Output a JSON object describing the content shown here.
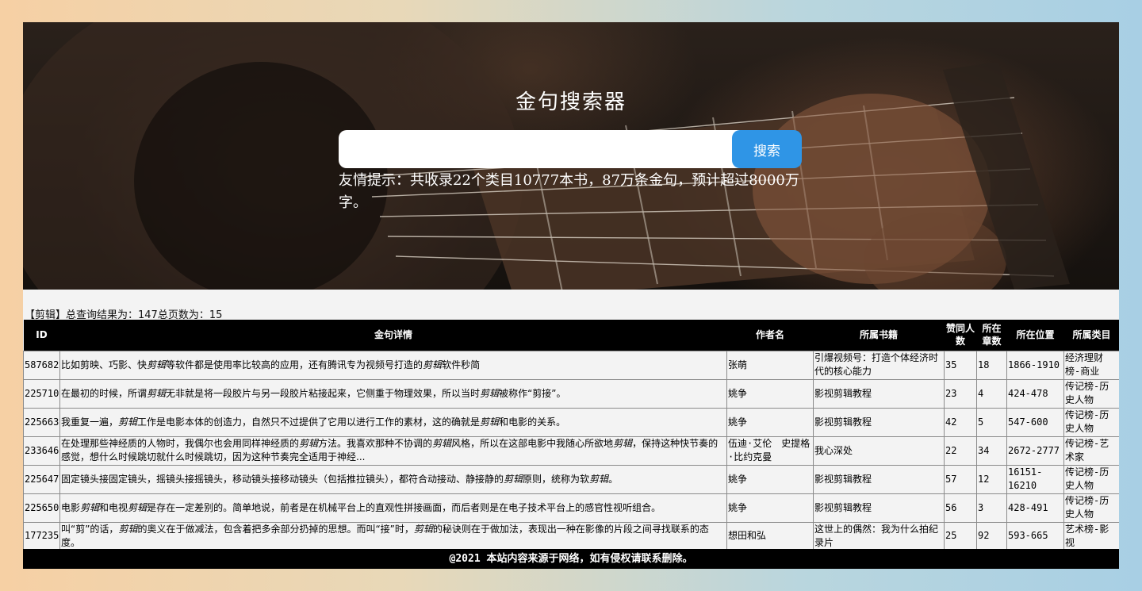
{
  "hero": {
    "title": "金句搜索器",
    "search_placeholder": "",
    "search_value": "",
    "search_button": "搜索",
    "hint": "友情提示：共收录22个类目10777本书，87万条金句，预计超过8000万字。"
  },
  "results": {
    "summary": "【剪辑】总查询结果为：147总页数为：15",
    "keyword": "剪辑",
    "columns": [
      "ID",
      "金句详情",
      "作者名",
      "所属书籍",
      "赞同人数",
      "所在章数",
      "所在位置",
      "所属类目"
    ],
    "rows": [
      {
        "id": "587682",
        "detail": "比如剪映、巧影、快剪辑等软件都是使用率比较高的应用，还有腾讯专为视频号打造的剪辑软件秒简",
        "author": "张萌",
        "book": "引爆视频号：打造个体经济时代的核心能力",
        "likes": "35",
        "chapter": "18",
        "position": "1866-1910",
        "category": "经济理财榜-商业"
      },
      {
        "id": "225710",
        "detail": "在最初的时候，所谓剪辑无非就是将一段胶片与另一段胶片粘接起来，它侧重于物理效果，所以当时剪辑被称作“剪接”。",
        "author": "姚争",
        "book": "影视剪辑教程",
        "likes": "23",
        "chapter": "4",
        "position": "424-478",
        "category": "传记榜-历史人物"
      },
      {
        "id": "225663",
        "detail": "我重复一遍，剪辑工作是电影本体的创造力，自然只不过提供了它用以进行工作的素材，这的确就是剪辑和电影的关系。",
        "author": "姚争",
        "book": "影视剪辑教程",
        "likes": "42",
        "chapter": "5",
        "position": "547-600",
        "category": "传记榜-历史人物"
      },
      {
        "id": "233646",
        "detail": "在处理那些神经质的人物时，我偶尔也会用同样神经质的剪辑方法。我喜欢那种不协调的剪辑风格，所以在这部电影中我随心所欲地剪辑，保持这种快节奏的感觉，想什么时候跳切就什么时候跳切，因为这种节奏完全适用于神经...",
        "author": "伍迪·艾伦　史提格·比约克曼",
        "book": "我心深处",
        "likes": "22",
        "chapter": "34",
        "position": "2672-2777",
        "category": "传记榜-艺术家"
      },
      {
        "id": "225647",
        "detail": "固定镜头接固定镜头，摇镜头接摇镜头，移动镜头接移动镜头（包括推拉镜头），都符合动接动、静接静的剪辑原则，统称为软剪辑。",
        "author": "姚争",
        "book": "影视剪辑教程",
        "likes": "57",
        "chapter": "12",
        "position": "16151-16210",
        "category": "传记榜-历史人物"
      },
      {
        "id": "225650",
        "detail": "电影剪辑和电视剪辑是存在一定差别的。简单地说，前者是在机械平台上的直观性拼接画面，而后者则是在电子技术平台上的感官性视听组合。",
        "author": "姚争",
        "book": "影视剪辑教程",
        "likes": "56",
        "chapter": "3",
        "position": "428-491",
        "category": "传记榜-历史人物"
      },
      {
        "id": "177235",
        "detail": "叫“剪”的话，剪辑的奥义在于做减法，包含着把多余部分扔掉的思想。而叫“接”时，剪辑的秘诀则在于做加法，表现出一种在影像的片段之间寻找联系的态度。",
        "author": "想田和弘",
        "book": "这世上的偶然：我为什么拍纪录片",
        "likes": "25",
        "chapter": "92",
        "position": "593-665",
        "category": "艺术榜-影视"
      }
    ]
  },
  "footer": {
    "text": "@2021 本站内容来源于网络，如有侵权请联系删除。"
  }
}
